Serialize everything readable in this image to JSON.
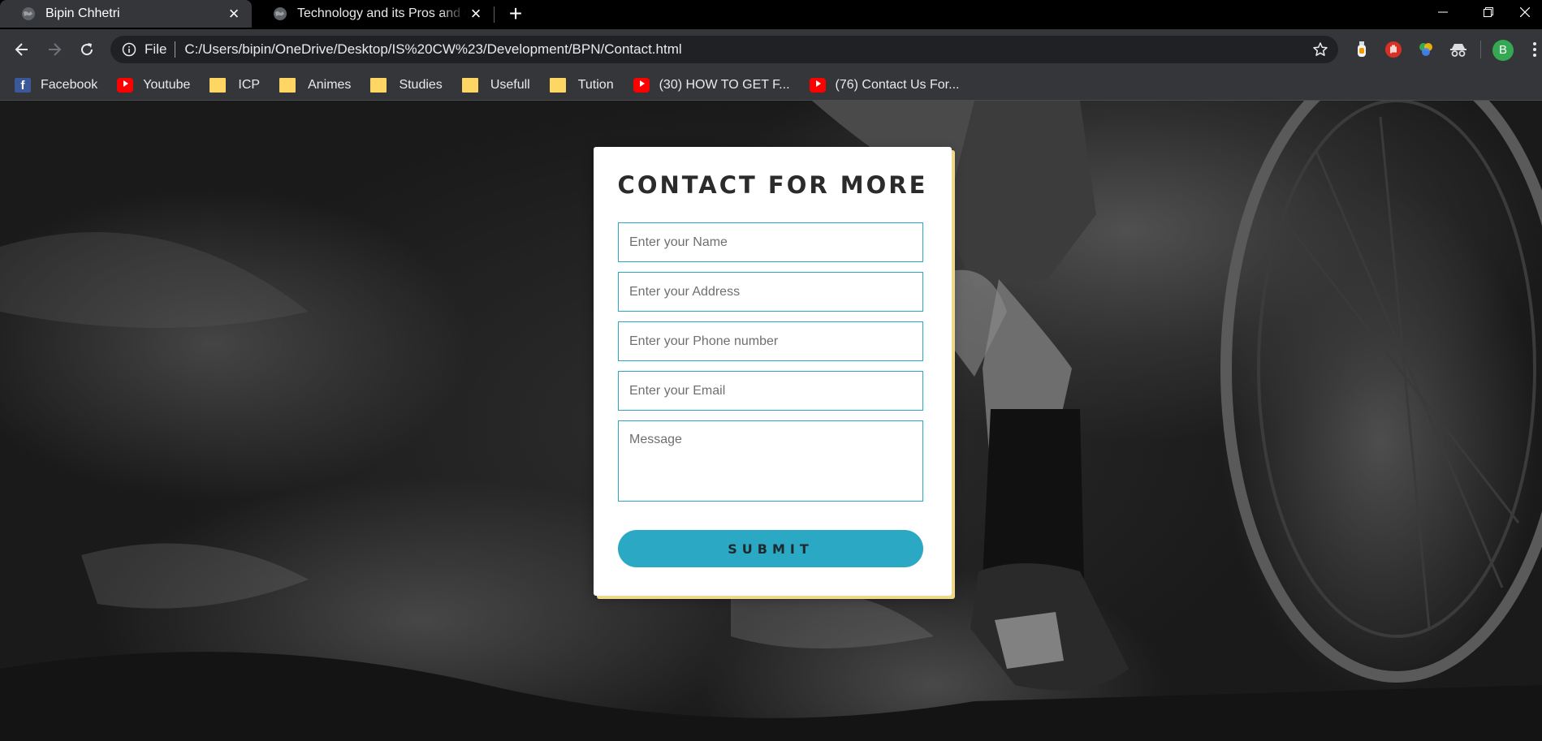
{
  "browser": {
    "tabs": [
      {
        "title": "Bipin Chhetri",
        "active": true
      },
      {
        "title": "Technology and its Pros and Cons",
        "active": false
      }
    ],
    "address": {
      "scheme_label": "File",
      "url": "C:/Users/bipin/OneDrive/Desktop/IS%20CW%23/Development/BPN/Contact.html"
    },
    "profile_initial": "B",
    "bookmarks": [
      {
        "label": "Facebook",
        "icon": "facebook-icon"
      },
      {
        "label": "Youtube",
        "icon": "youtube-icon"
      },
      {
        "label": "ICP",
        "icon": "folder-icon"
      },
      {
        "label": "Animes",
        "icon": "folder-icon"
      },
      {
        "label": "Studies",
        "icon": "folder-icon"
      },
      {
        "label": "Usefull",
        "icon": "folder-icon"
      },
      {
        "label": "Tution",
        "icon": "folder-icon"
      },
      {
        "label": "(30) HOW TO GET F...",
        "icon": "youtube-icon"
      },
      {
        "label": "(76) Contact Us For...",
        "icon": "youtube-icon"
      }
    ]
  },
  "contact": {
    "heading": "CONTACT FOR MORE",
    "fields": {
      "name_placeholder": "Enter your Name",
      "address_placeholder": "Enter your Address",
      "phone_placeholder": "Enter your Phone number",
      "email_placeholder": "Enter your Email",
      "message_placeholder": "Message"
    },
    "submit_label": "SUBMIT"
  },
  "colors": {
    "accent": "#2aa8c4",
    "card_shadow": "#f0d88a",
    "chrome_dark": "#35363a"
  }
}
